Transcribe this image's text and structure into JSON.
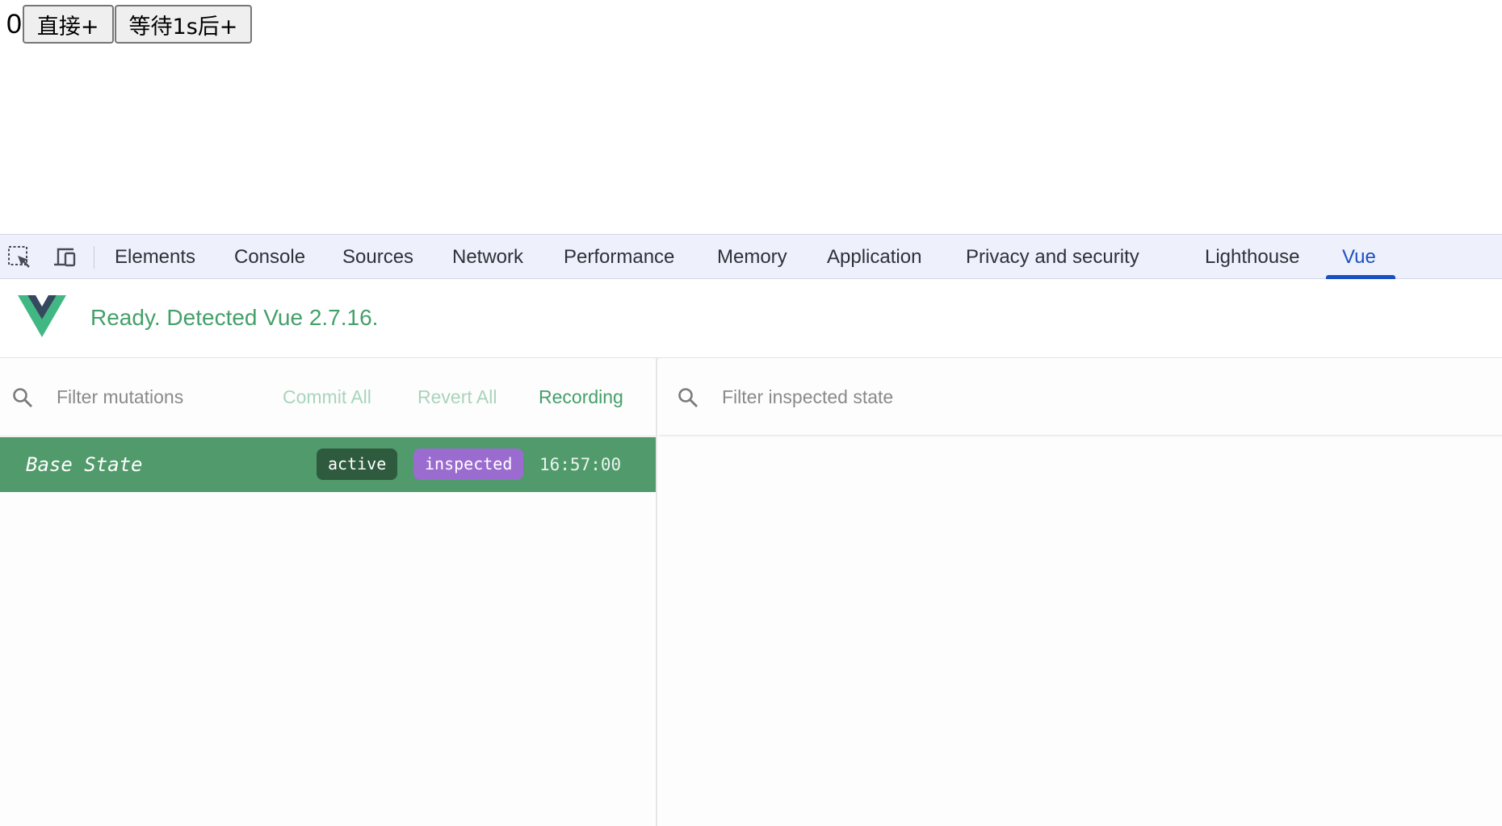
{
  "page": {
    "counter": "0",
    "buttons": [
      "直接+",
      "等待1s后+"
    ]
  },
  "devtools": {
    "toolbar_icons": [
      "inspect-element-icon",
      "device-toolbar-icon"
    ],
    "tabs": [
      {
        "label": "Elements"
      },
      {
        "label": "Console"
      },
      {
        "label": "Sources"
      },
      {
        "label": "Network"
      },
      {
        "label": "Performance"
      },
      {
        "label": "Memory"
      },
      {
        "label": "Application"
      },
      {
        "label": "Privacy and security"
      },
      {
        "label": "Lighthouse"
      },
      {
        "label": "Vue",
        "active": true
      }
    ],
    "active_tab_color": "#1b4fc4"
  },
  "vue": {
    "status": "Ready. Detected Vue 2.7.16.",
    "brand_green": "#44a06a",
    "vuex": {
      "filter_mutations_placeholder": "Filter mutations",
      "commit_all": "Commit All",
      "revert_all": "Revert All",
      "recording": "Recording",
      "mutations": [
        {
          "name": "Base State",
          "badges": [
            "active",
            "inspected"
          ],
          "time": "16:57:00"
        }
      ],
      "filter_state_placeholder": "Filter inspected state"
    }
  }
}
